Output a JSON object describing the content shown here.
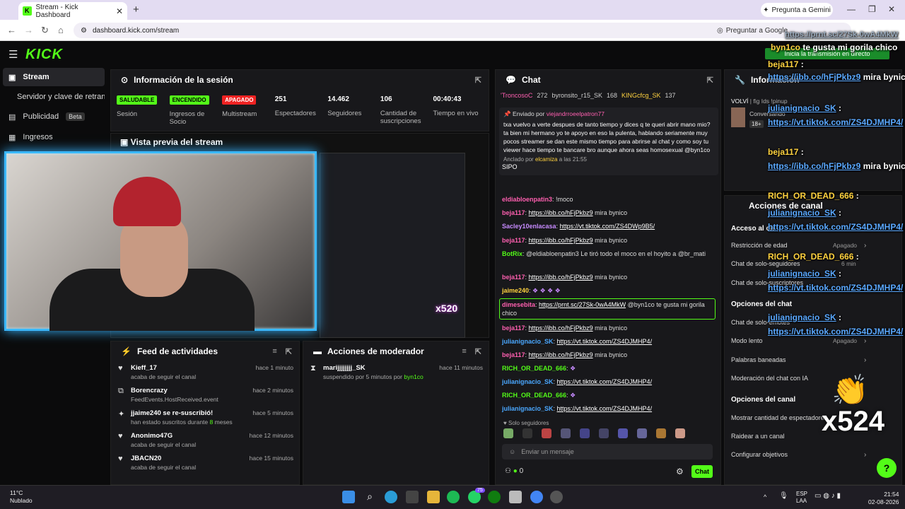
{
  "browser": {
    "tab_title": "Stream - Kick Dashboard",
    "gemini": "Pregunta a Gemini",
    "url": "dashboard.kick.com/stream",
    "ask_google": "Preguntar a Google"
  },
  "brand": {
    "logo": "KICK",
    "accent": "#53fc18"
  },
  "sidebar": {
    "items": [
      {
        "label": "Stream"
      },
      {
        "label": "Servidor y clave de retransm"
      },
      {
        "label": "Publicidad",
        "badge": "Beta"
      },
      {
        "label": "Ingresos"
      }
    ]
  },
  "session": {
    "title": "Información de la sesión",
    "stats": [
      {
        "badge": "SALUDABLE",
        "label": "Sesión"
      },
      {
        "badge": "ENCENDIDO",
        "label": "Ingresos de Socio"
      },
      {
        "badge": "APAGADO",
        "label": "Multistream"
      },
      {
        "value": "251",
        "label": "Espectadores"
      },
      {
        "value": "14.462",
        "label": "Seguidores"
      },
      {
        "value": "106",
        "label": "Cantidad de suscripciones"
      },
      {
        "value": "00:40:43",
        "label": "Tiempo en vivo"
      }
    ]
  },
  "preview": {
    "title": "Vista previa del stream",
    "overlay_count": "x520"
  },
  "feed": {
    "title": "Feed de actividades",
    "items": [
      {
        "name": "Kieff_17",
        "sub": "acaba de seguir el canal",
        "time": "hace 1 minuto"
      },
      {
        "name": "Borencrazy",
        "sub": "FeedEvents.HostReceived.event",
        "time": "hace 2 minutos"
      },
      {
        "name": "jjaime240 se re-suscribió!",
        "sub": "han estado suscritos durante",
        "sub_count": "8",
        "sub_unit": "meses",
        "time": "hace 5 minutos"
      },
      {
        "name": "Anonimo47G",
        "sub": "acaba de seguir el canal",
        "time": "hace 12 minutos"
      },
      {
        "name": "JBACN20",
        "sub": "acaba de seguir el canal",
        "time": "hace 15 minutos"
      }
    ]
  },
  "mod": {
    "title": "Acciones de moderador",
    "items": [
      {
        "name": "marijjjjjjjj_SK",
        "sub": "suspendido por 5 minutos por",
        "by": "byn1co",
        "time": "hace 11 minutos"
      }
    ]
  },
  "chat": {
    "title": "Chat",
    "top_users": [
      {
        "name": "'TroncosoC",
        "count": "272"
      },
      {
        "name": "byronsito_r15_SK",
        "count": "168"
      },
      {
        "name": "KINGcfcg_SK",
        "count": "137"
      }
    ],
    "pinned": {
      "sent_by_label": "Enviado por",
      "sent_by": "viejandrroeelpatron77",
      "text": "txa vuelvo a verte despues de tanto tiempo y dices q te queri abrir mano mio? ta bien mi hermano yo te apoyo en eso la pulenta, hablando seriamente muy pocos streamer se dan este mismo tiempo para abrirse al chat y como soy tu viewer hace tiempo te bancare bro aunque ahora seas homosexual @byn1co",
      "anchored_label": "Anclado por",
      "anchored_by": "elcamiza",
      "anchored_time": "a las 21:55"
    },
    "messages": [
      {
        "user": "SIPO",
        "text": ""
      },
      {
        "user": "eldiabloenpatin3",
        "text": "!moco"
      },
      {
        "user": "beja117",
        "link": "https://ibb.co/hFjPkbz9",
        "text": "mira bynico"
      },
      {
        "user": "Sacley10enlacasa",
        "link": "https://vt.tiktok.com/ZS4DWp9B5/",
        "text": ""
      },
      {
        "user": "beja117",
        "link": "https://ibb.co/hFjPkbz9",
        "text": "mira bynico"
      },
      {
        "user": "BotRix",
        "text": "@eldiabloenpatin3 Le tiró todo el moco en el hoyito a @br_mati"
      },
      {
        "user": "beja117",
        "link": "https://ibb.co/hFjPkbz9",
        "text": "mira bynico"
      },
      {
        "user": "jaime240",
        "text": ""
      },
      {
        "user": "dimesebita",
        "link": "https://prnt.sc/27Sk-0wA4MkW",
        "text": "@byn1co te gusta mi gorila chico"
      },
      {
        "user": "beja117",
        "link": "https://ibb.co/hFjPkbz9",
        "text": "mira bynico"
      },
      {
        "user": "julianignacio_SK",
        "link": "https://vt.tiktok.com/ZS4DJMHP4/",
        "text": ""
      },
      {
        "user": "beja117",
        "link": "https://ibb.co/hFjPkbz9",
        "text": "mira bynico"
      },
      {
        "user": "RICH_OR_DEAD_666",
        "text": ""
      },
      {
        "user": "julianignacio_SK",
        "link": "https://vt.tiktok.com/ZS4DJMHP4/",
        "text": ""
      },
      {
        "user": "RICH_OR_DEAD_666",
        "text": ""
      },
      {
        "user": "julianignacio_SK",
        "link": "https://vt.tiktok.com/ZS4DJMHP4/",
        "text": ""
      }
    ],
    "solo": "Solo seguidores",
    "placeholder": "Enviar un mensaje",
    "send": "Chat",
    "footer_count": "0"
  },
  "info": {
    "title": "Información",
    "volvi": "VOLVÍ",
    "conversando": "Conversando",
    "age": "18+",
    "tags": "| fig Ids !pinup"
  },
  "acciones": {
    "title": "Acciones de canal",
    "rows": [
      {
        "label": "Acceso al ch",
        "head": true
      },
      {
        "label": "Restricción de edad",
        "value": "Apagado"
      },
      {
        "label": "Chat de solo-seguidores",
        "value": "6 min"
      },
      {
        "label": "Chat de solo-suscriptores"
      },
      {
        "label": "Opciones del chat",
        "head": true
      },
      {
        "label": "Chat de solo-emotes"
      },
      {
        "label": "Modo lento",
        "value": "Apagado"
      },
      {
        "label": "Palabras baneadas"
      },
      {
        "label": "Moderación del chat con IA"
      },
      {
        "label": "Opciones del canal",
        "head": true
      },
      {
        "label": "Mostrar cantidad de espectadores"
      },
      {
        "label": "Raidear a un canal"
      },
      {
        "label": "Configurar objetivos"
      }
    ]
  },
  "overlay": {
    "banner": "Inicia la transmisión en directo",
    "top_link": "https://prnt.sc/27Sk-0wA4MkW",
    "lines": [
      {
        "user": "byn1co",
        "text": "te gusta mi gorila chico"
      },
      {
        "user": "beja117",
        "link": "https://ibb.co/hFjPkbz9",
        "text": "mira bynico"
      },
      {
        "user": "julianignacio_SK",
        "link": "https://vt.tiktok.com/ZS4DJMHP4/"
      },
      {
        "user": "beja117",
        "link": "https://ibb.co/hFjPkbz9",
        "text": "mira bynico"
      },
      {
        "user": "RICH_OR_DEAD_666"
      },
      {
        "user": "julianignacio_SK",
        "link": "https://vt.tiktok.com/ZS4DJMHP4/"
      },
      {
        "user": "RICH_OR_DEAD_666"
      },
      {
        "user": "julianignacio_SK",
        "link": "https://vt.tiktok.com/ZS4DJMHP4/"
      },
      {
        "user": "julianignacio_SK",
        "link": "https://vt.tiktok.com/ZS4DJMHP4/"
      }
    ],
    "count": "x524"
  },
  "taskbar": {
    "temp": "11°C",
    "weather": "Nublado",
    "lang1": "ESP",
    "lang2": "LAA",
    "time": "21:54",
    "date": "02-08-2026",
    "badge": "75"
  }
}
